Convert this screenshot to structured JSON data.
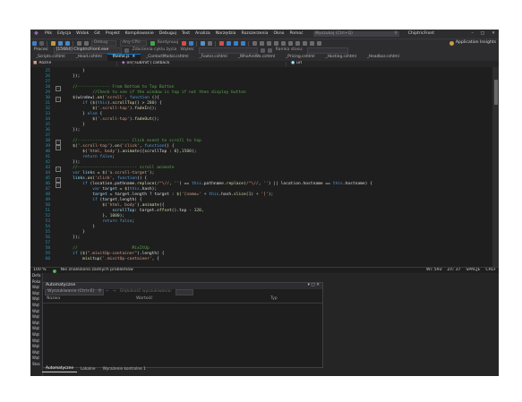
{
  "menubar": {
    "items": [
      "Plik",
      "Edycja",
      "Widok",
      "Git",
      "Projekt",
      "Kompilowanie",
      "Debuguj",
      "Test",
      "Analiza",
      "Narzędzia",
      "Rozszerzenia",
      "Okno",
      "Pomoc"
    ],
    "search_placeholder": "Wyszukaj (Ctrl+Q)",
    "project_name": "ChiptricFront"
  },
  "toolbar": {
    "config_combo": "Debug",
    "platform_combo": "Any CPU",
    "run_label": "Kontynuuj",
    "app_insights": "Application Insights"
  },
  "procbar": {
    "process_label": "Proces:",
    "process_value": "[15664] ChiptricFront.exe",
    "lifecycle_label": "Zdarzenia cyklu życia",
    "thread_label": "Wątek:",
    "stack_label": "Ramka stosu:"
  },
  "tabs": [
    "_Scripts.cshtml",
    "_Head.cshtml",
    "theme.js",
    "_ContactModal.cshtml",
    "_Footer.cshtml",
    "_WhoAreWe.cshtml",
    "_Pricing.cshtml",
    "_Hosting.cshtml",
    "_Headbar.cshtml"
  ],
  "active_tab_index": 2,
  "navbar": {
    "scope": "Różne",
    "member": "on('submit') callback",
    "extra": "url"
  },
  "editor": {
    "line_numbers": [
      "25",
      "26",
      "27",
      "28",
      "29",
      "30",
      "31",
      "32",
      "33",
      "34",
      "35",
      "36",
      "37",
      "38",
      "39",
      "40",
      "41",
      "42",
      "43",
      "44",
      "45",
      "46",
      "47",
      "48",
      "49",
      "50",
      "51",
      "52",
      "53",
      "54",
      "55",
      "56",
      "57",
      "58",
      "59",
      "60"
    ],
    "lines": [
      [
        {
          "t": "p",
          "v": "        }"
        }
      ],
      [
        {
          "t": "p",
          "v": "    });"
        }
      ],
      [
        {
          "t": "p",
          "v": ""
        }
      ],
      [
        {
          "t": "c",
          "v": "    //------------- From Bottom to Top Button"
        }
      ],
      [
        {
          "t": "c",
          "v": "            //Check to see if the window is top if not then display button"
        }
      ],
      [
        {
          "t": "f",
          "v": "    $"
        },
        {
          "t": "p",
          "v": "(window)."
        },
        {
          "t": "f",
          "v": "on"
        },
        {
          "t": "p",
          "v": "("
        },
        {
          "t": "s",
          "v": "'scroll'"
        },
        {
          "t": "p",
          "v": ", "
        },
        {
          "t": "k",
          "v": "function"
        },
        {
          "t": "p",
          "v": " (){"
        }
      ],
      [
        {
          "t": "k",
          "v": "        if"
        },
        {
          "t": "p",
          "v": " ("
        },
        {
          "t": "f",
          "v": "$"
        },
        {
          "t": "p",
          "v": "("
        },
        {
          "t": "k",
          "v": "this"
        },
        {
          "t": "p",
          "v": ")."
        },
        {
          "t": "f",
          "v": "scrollTop"
        },
        {
          "t": "p",
          "v": "() > "
        },
        {
          "t": "n",
          "v": "200"
        },
        {
          "t": "p",
          "v": ") {"
        }
      ],
      [
        {
          "t": "f",
          "v": "            $"
        },
        {
          "t": "p",
          "v": "("
        },
        {
          "t": "s",
          "v": "'.scroll-top'"
        },
        {
          "t": "p",
          "v": ")."
        },
        {
          "t": "f",
          "v": "fadeIn"
        },
        {
          "t": "p",
          "v": "();"
        }
      ],
      [
        {
          "t": "p",
          "v": "        } "
        },
        {
          "t": "k",
          "v": "else"
        },
        {
          "t": "p",
          "v": " {"
        }
      ],
      [
        {
          "t": "f",
          "v": "            $"
        },
        {
          "t": "p",
          "v": "("
        },
        {
          "t": "s",
          "v": "'.scroll-top'"
        },
        {
          "t": "p",
          "v": ")."
        },
        {
          "t": "f",
          "v": "fadeOut"
        },
        {
          "t": "p",
          "v": "();"
        }
      ],
      [
        {
          "t": "p",
          "v": "        }"
        }
      ],
      [
        {
          "t": "p",
          "v": "    });"
        }
      ],
      [
        {
          "t": "p",
          "v": ""
        }
      ],
      [
        {
          "t": "c",
          "v": "    //--------------------- Click event to scroll to top"
        }
      ],
      [
        {
          "t": "f",
          "v": "    $"
        },
        {
          "t": "p",
          "v": "("
        },
        {
          "t": "s",
          "v": "'.scroll-top'"
        },
        {
          "t": "p",
          "v": ")."
        },
        {
          "t": "f",
          "v": "on"
        },
        {
          "t": "p",
          "v": "("
        },
        {
          "t": "s",
          "v": "'click'"
        },
        {
          "t": "p",
          "v": ", "
        },
        {
          "t": "k",
          "v": "function"
        },
        {
          "t": "p",
          "v": "() {"
        }
      ],
      [
        {
          "t": "f",
          "v": "        $"
        },
        {
          "t": "p",
          "v": "("
        },
        {
          "t": "s",
          "v": "'html, body'"
        },
        {
          "t": "p",
          "v": ")."
        },
        {
          "t": "f",
          "v": "animate"
        },
        {
          "t": "p",
          "v": "({scrollTop : "
        },
        {
          "t": "n",
          "v": "0"
        },
        {
          "t": "p",
          "v": "},"
        },
        {
          "t": "n",
          "v": "1500"
        },
        {
          "t": "p",
          "v": ");"
        }
      ],
      [
        {
          "t": "k",
          "v": "        return false"
        },
        {
          "t": "p",
          "v": ";"
        }
      ],
      [
        {
          "t": "p",
          "v": "    });"
        }
      ],
      [
        {
          "t": "c",
          "v": "    //------------------------ scroll animate"
        }
      ],
      [
        {
          "t": "k",
          "v": "    var"
        },
        {
          "t": "v",
          "v": " links"
        },
        {
          "t": "p",
          "v": " = "
        },
        {
          "t": "f",
          "v": "$"
        },
        {
          "t": "p",
          "v": "("
        },
        {
          "t": "s",
          "v": "'a.scroll-target'"
        },
        {
          "t": "p",
          "v": ");"
        }
      ],
      [
        {
          "t": "v",
          "v": "    links"
        },
        {
          "t": "p",
          "v": "."
        },
        {
          "t": "f",
          "v": "on"
        },
        {
          "t": "p",
          "v": "("
        },
        {
          "t": "s",
          "v": "'click'"
        },
        {
          "t": "p",
          "v": ", "
        },
        {
          "t": "k",
          "v": "function"
        },
        {
          "t": "p",
          "v": "() {"
        }
      ],
      [
        {
          "t": "k",
          "v": "        if"
        },
        {
          "t": "p",
          "v": " (location.pathname."
        },
        {
          "t": "f",
          "v": "replace"
        },
        {
          "t": "p",
          "v": "("
        },
        {
          "t": "s",
          "v": "/^\\//"
        },
        {
          "t": "p",
          "v": ", "
        },
        {
          "t": "s",
          "v": "''"
        },
        {
          "t": "p",
          "v": ") == "
        },
        {
          "t": "k",
          "v": "this"
        },
        {
          "t": "p",
          "v": ".pathname."
        },
        {
          "t": "f",
          "v": "replace"
        },
        {
          "t": "p",
          "v": "("
        },
        {
          "t": "s",
          "v": "/^\\//"
        },
        {
          "t": "p",
          "v": ", "
        },
        {
          "t": "s",
          "v": "''"
        },
        {
          "t": "p",
          "v": ") || location.hostname == "
        },
        {
          "t": "k",
          "v": "this"
        },
        {
          "t": "p",
          "v": ".hostname) {"
        }
      ],
      [
        {
          "t": "k",
          "v": "            var"
        },
        {
          "t": "v",
          "v": " target"
        },
        {
          "t": "p",
          "v": " = "
        },
        {
          "t": "f",
          "v": "$"
        },
        {
          "t": "p",
          "v": "("
        },
        {
          "t": "k",
          "v": "this"
        },
        {
          "t": "p",
          "v": ".hash);"
        }
      ],
      [
        {
          "t": "v",
          "v": "            target"
        },
        {
          "t": "p",
          "v": " = target.length ? target : "
        },
        {
          "t": "f",
          "v": "$"
        },
        {
          "t": "p",
          "v": "("
        },
        {
          "t": "s",
          "v": "'[name='"
        },
        {
          "t": "p",
          "v": " + "
        },
        {
          "t": "k",
          "v": "this"
        },
        {
          "t": "p",
          "v": ".hash."
        },
        {
          "t": "f",
          "v": "slice"
        },
        {
          "t": "p",
          "v": "("
        },
        {
          "t": "n",
          "v": "1"
        },
        {
          "t": "p",
          "v": ") + "
        },
        {
          "t": "s",
          "v": "']'"
        },
        {
          "t": "p",
          "v": ");"
        }
      ],
      [
        {
          "t": "k",
          "v": "            if"
        },
        {
          "t": "p",
          "v": " (target.length) {"
        }
      ],
      [
        {
          "t": "f",
          "v": "                $"
        },
        {
          "t": "p",
          "v": "("
        },
        {
          "t": "s",
          "v": "'html, body'"
        },
        {
          "t": "p",
          "v": ")."
        },
        {
          "t": "f",
          "v": "animate"
        },
        {
          "t": "p",
          "v": "({"
        }
      ],
      [
        {
          "t": "v",
          "v": "                    scrollTop"
        },
        {
          "t": "p",
          "v": ": target."
        },
        {
          "t": "f",
          "v": "offset"
        },
        {
          "t": "p",
          "v": "().top - "
        },
        {
          "t": "n",
          "v": "120"
        },
        {
          "t": "p",
          "v": ","
        }
      ],
      [
        {
          "t": "p",
          "v": "                }, "
        },
        {
          "t": "n",
          "v": "1000"
        },
        {
          "t": "p",
          "v": ");"
        }
      ],
      [
        {
          "t": "k",
          "v": "                return false"
        },
        {
          "t": "p",
          "v": ";"
        }
      ],
      [
        {
          "t": "p",
          "v": "            }"
        }
      ],
      [
        {
          "t": "p",
          "v": "        }"
        }
      ],
      [
        {
          "t": "p",
          "v": "    });"
        }
      ],
      [
        {
          "t": "p",
          "v": ""
        }
      ],
      [
        {
          "t": "c",
          "v": "    //                      MixItUp"
        }
      ],
      [
        {
          "t": "k",
          "v": "    if"
        },
        {
          "t": "p",
          "v": " ("
        },
        {
          "t": "f",
          "v": "$"
        },
        {
          "t": "p",
          "v": "("
        },
        {
          "t": "s",
          "v": "\".mixitUp-container\""
        },
        {
          "t": "p",
          "v": ").length) {"
        }
      ],
      [
        {
          "t": "f",
          "v": "        mixitup"
        },
        {
          "t": "p",
          "v": "("
        },
        {
          "t": "s",
          "v": "'.mixitUp-container'"
        },
        {
          "t": "p",
          "v": ", {"
        }
      ]
    ]
  },
  "statusbar": {
    "zoom": "100 %",
    "issues": "Nie znaleziono żadnych problemów",
    "line": "Wi: 593",
    "char": "Zn: 37",
    "spaces": "SPACJE",
    "eol": "CRLF"
  },
  "bottom": {
    "left_items": [
      "Defa",
      "Poko",
      "Wąt",
      "Wąt",
      "Wąt",
      "Wąt",
      "Wąt",
      "Wąt",
      "Wąt",
      "Wąt",
      "Wąt",
      "Wąt",
      "Wąt",
      "Wąt",
      "Wąt",
      "Stos"
    ],
    "autos_title": "Automatyczne",
    "search_placeholder": "Wyszukiwanie (Ctrl+E)",
    "search_depth_label": "Głębokość wyszukiwania:",
    "columns": [
      "Nazwa",
      "Wartość",
      "Typ"
    ],
    "tabs": [
      "Automatyczne",
      "Lokalne",
      "Wyrażenie kontrolne 1"
    ]
  },
  "colors": {
    "accent": "#007acc",
    "keyword": "#569cd6",
    "string": "#d69d85",
    "comment": "#57a64a",
    "function": "#dcdcaa",
    "number": "#b5cea8"
  }
}
